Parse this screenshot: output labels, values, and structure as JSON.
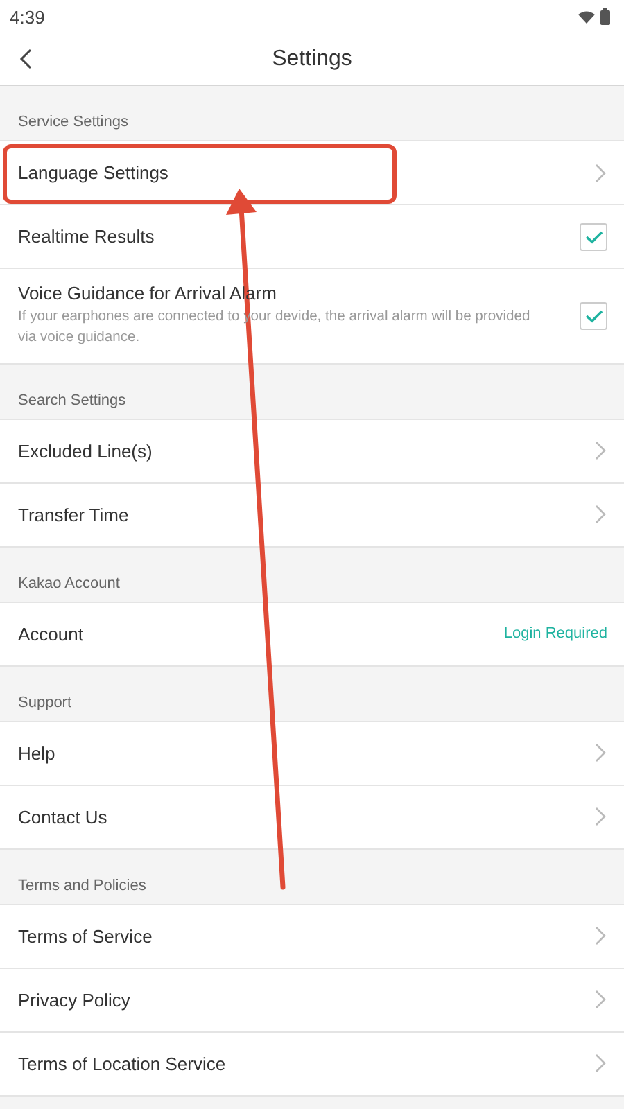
{
  "status_bar": {
    "time": "4:39"
  },
  "header": {
    "title": "Settings"
  },
  "sections": [
    {
      "title": "Service Settings",
      "items": [
        {
          "kind": "link",
          "label": "Language Settings",
          "highlighted": true
        },
        {
          "kind": "checkbox",
          "label": "Realtime Results",
          "checked": true,
          "highlighted": false
        },
        {
          "kind": "checkbox",
          "label": "Voice Guidance for Arrival Alarm",
          "description": "If your earphones are connected to your devide, the arrival alarm will be provided via voice guidance.",
          "checked": true,
          "highlighted": false
        }
      ]
    },
    {
      "title": "Search Settings",
      "items": [
        {
          "kind": "link",
          "label": "Excluded Line(s)",
          "highlighted": false
        },
        {
          "kind": "link",
          "label": "Transfer Time",
          "highlighted": false
        }
      ]
    },
    {
      "title": "Kakao Account",
      "items": [
        {
          "kind": "value",
          "label": "Account",
          "value": "Login Required",
          "highlighted": false
        }
      ]
    },
    {
      "title": "Support",
      "items": [
        {
          "kind": "link",
          "label": "Help",
          "highlighted": false
        },
        {
          "kind": "link",
          "label": "Contact Us",
          "highlighted": false
        }
      ]
    },
    {
      "title": "Terms and Policies",
      "items": [
        {
          "kind": "link",
          "label": "Terms of Service",
          "highlighted": false
        },
        {
          "kind": "link",
          "label": "Privacy Policy",
          "highlighted": false
        },
        {
          "kind": "link",
          "label": "Terms of Location Service",
          "highlighted": false
        }
      ]
    }
  ]
}
